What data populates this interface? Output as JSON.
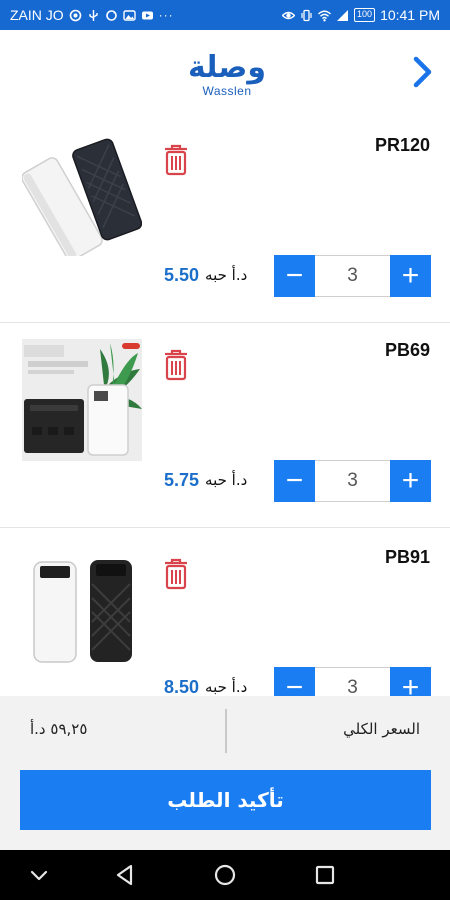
{
  "status_bar": {
    "carrier": "ZAIN JO",
    "battery": "100",
    "time": "10:41 PM",
    "bg_color": "#1769d2"
  },
  "header": {
    "logo_arabic": "وصلة",
    "logo_english": "Wasslen",
    "back_icon": "chevron-right-icon",
    "accent_color": "#1b5fbd"
  },
  "cart": {
    "items": [
      {
        "name": "PR120",
        "price": "5.50",
        "currency": "د.أ حبه",
        "quantity": "3",
        "image": "white-and-black-power-banks"
      },
      {
        "name": "PB69",
        "price": "5.75",
        "currency": "د.أ حبه",
        "quantity": "3",
        "image": "power-bank-with-box-and-plant"
      },
      {
        "name": "PB91",
        "price": "8.50",
        "currency": "د.أ حبه",
        "quantity": "3",
        "image": "white-and-black-patterned-power-banks"
      }
    ],
    "minus_symbol": "−",
    "plus_symbol": "+",
    "delete_icon": "trash-icon",
    "button_color": "#1a7df2",
    "price_color": "#1b6ec9",
    "delete_color": "#d9434b"
  },
  "total": {
    "label": "السعر الكلي",
    "amount": "٥٩,٢٥ د.أ"
  },
  "confirm": {
    "label": "تأكيد الطلب"
  },
  "nav_bar": {
    "icons": [
      "chevron-down-icon",
      "back-triangle-icon",
      "home-circle-icon",
      "recents-square-icon"
    ]
  }
}
